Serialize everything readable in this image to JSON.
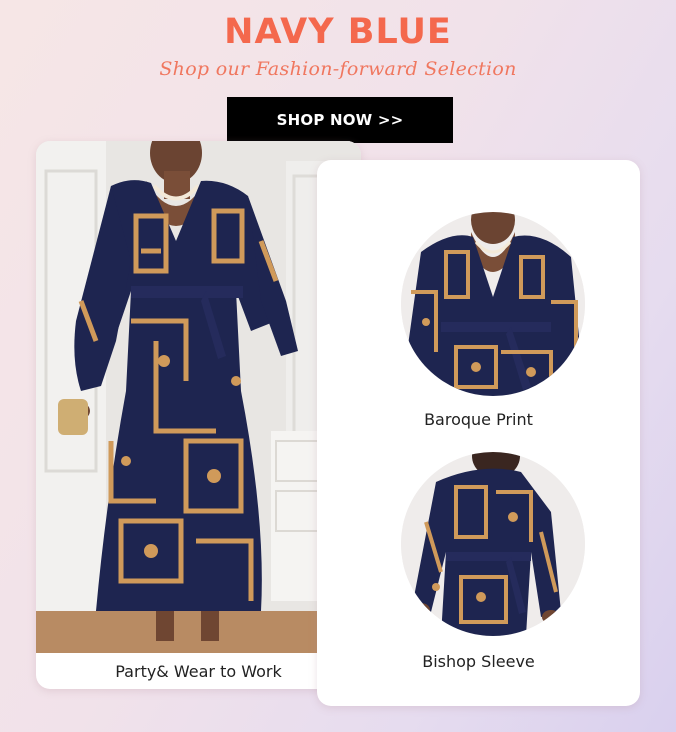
{
  "header": {
    "title": "NAVY BLUE",
    "subtitle": "Shop our Fashion-forward Selection",
    "cta_label": "SHOP NOW >>"
  },
  "products": {
    "main": {
      "caption": "Party& Wear to Work"
    },
    "detail_1": {
      "caption": "Baroque Print"
    },
    "detail_2": {
      "caption": "Bishop Sleeve"
    }
  },
  "colors": {
    "accent": "#f4684d",
    "dress_navy": "#1e2550",
    "print_gold": "#d09a5a",
    "button_bg": "#000000"
  }
}
